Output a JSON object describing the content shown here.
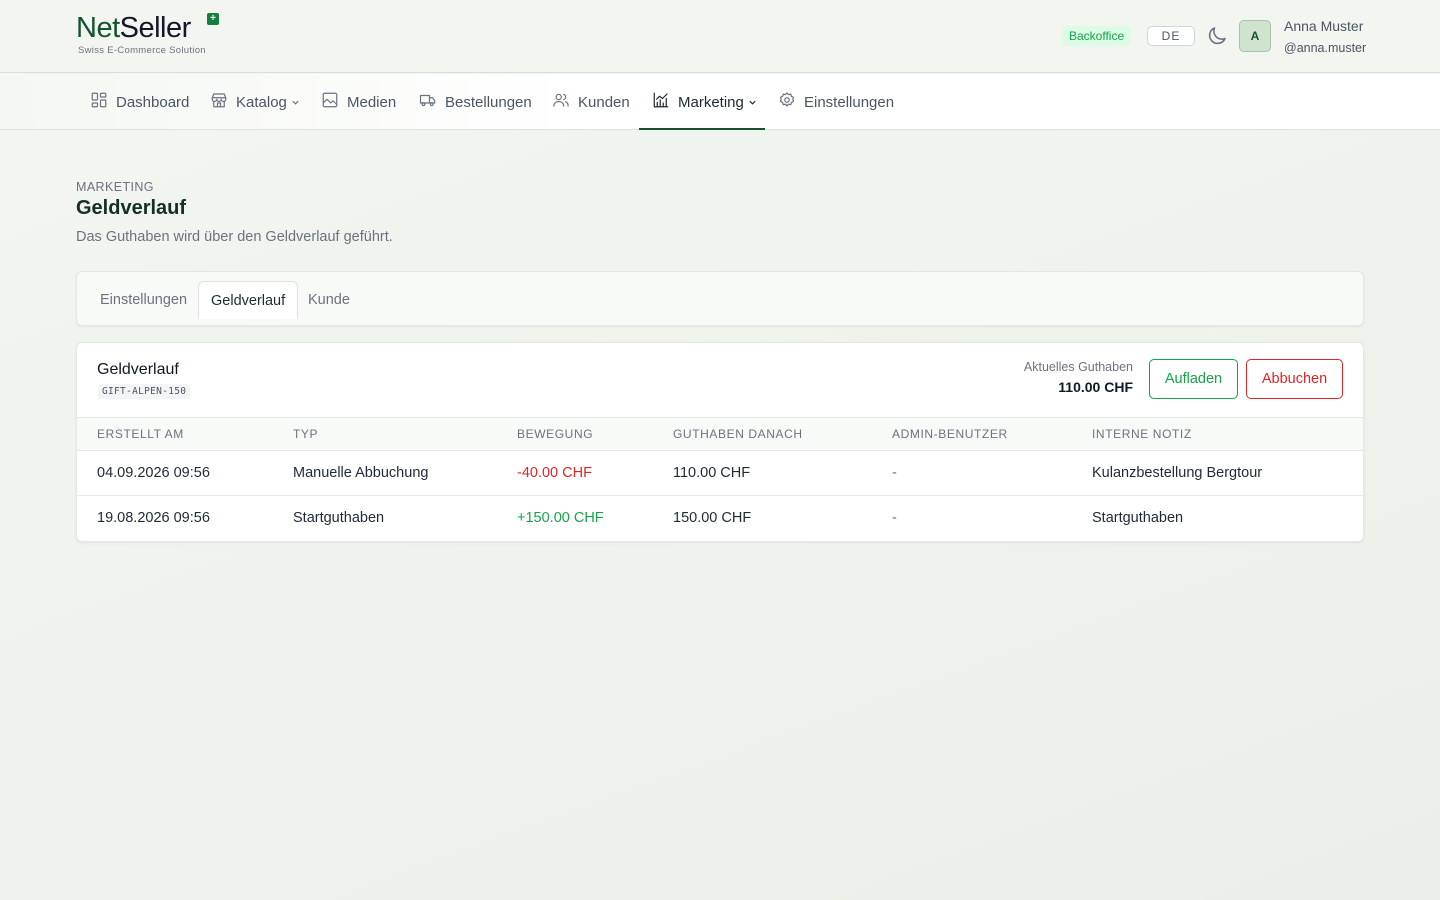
{
  "brand": {
    "name_part1": "Net",
    "name_part2": "Seller",
    "mark": "+",
    "tagline": "Swiss E-Commerce Solution"
  },
  "header": {
    "badge": "Backoffice",
    "language": "DE",
    "theme_icon": "moon-icon",
    "avatar_initial": "A",
    "user_name": "Anna Muster",
    "user_handle": "@anna.muster"
  },
  "nav": {
    "active": "Marketing",
    "items": [
      {
        "label": "Dashboard",
        "icon": "dashboard-icon"
      },
      {
        "label": "Katalog",
        "icon": "store-icon",
        "dropdown": true
      },
      {
        "label": "Medien",
        "icon": "image-icon"
      },
      {
        "label": "Bestellungen",
        "icon": "truck-icon"
      },
      {
        "label": "Kunden",
        "icon": "users-icon"
      },
      {
        "label": "Marketing",
        "icon": "chart-icon",
        "dropdown": true
      },
      {
        "label": "Einstellungen",
        "icon": "gear-icon"
      }
    ]
  },
  "page": {
    "breadcrumb": "MARKETING",
    "title": "Geldverlauf",
    "subtitle": "Das Guthaben wird über den Geldverlauf geführt."
  },
  "tabs": {
    "active": "Geldverlauf",
    "items": [
      "Einstellungen",
      "Geldverlauf",
      "Kunde"
    ]
  },
  "ledger": {
    "title": "Geldverlauf",
    "code": "GIFT-ALPEN-150",
    "balance_label": "Aktuelles Guthaben",
    "balance_value": "110.00 CHF",
    "charge_label": "Aufladen",
    "debit_label": "Abbuchen",
    "columns": [
      "ERSTELLT AM",
      "TYP",
      "BEWEGUNG",
      "GUTHABEN DANACH",
      "ADMIN-BENUTZER",
      "INTERNE NOTIZ"
    ],
    "rows": [
      {
        "created": "04.09.2026 09:56",
        "type": "Manuelle Abbuchung",
        "movement": "-40.00 CHF",
        "balance_after": "110.00 CHF",
        "admin": "-",
        "note": "Kulanzbestellung Bergtour"
      },
      {
        "created": "19.08.2026 09:56",
        "type": "Startguthaben",
        "movement": "+150.00 CHF",
        "balance_after": "150.00 CHF",
        "admin": "-",
        "note": "Startguthaben"
      }
    ]
  },
  "colors": {
    "brand_green": "#14532d",
    "positive": "#16a34a",
    "negative": "#dc2626"
  }
}
